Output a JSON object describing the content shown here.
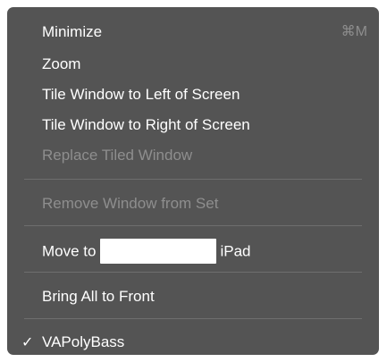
{
  "menu": {
    "items": {
      "minimize": {
        "label": "Minimize",
        "shortcut": "⌘M"
      },
      "zoom": {
        "label": "Zoom"
      },
      "tile_left": {
        "label": "Tile Window to Left of Screen"
      },
      "tile_right": {
        "label": "Tile Window to Right of Screen"
      },
      "replace_tiled": {
        "label": "Replace Tiled Window",
        "enabled": false
      },
      "remove_from_set": {
        "label": "Remove Window from Set",
        "enabled": false
      },
      "move_to": {
        "label_prefix": "Move to",
        "device": "iPad"
      },
      "bring_all_front": {
        "label": "Bring All to Front"
      },
      "window_vapolybass": {
        "label": "VAPolyBass",
        "checked": true,
        "check_mark": "✓"
      }
    }
  },
  "colors": {
    "menu_background": "#545454",
    "text_enabled": "#ffffff",
    "text_disabled": "#8e8e8e",
    "separator": "#6e6e6e"
  }
}
